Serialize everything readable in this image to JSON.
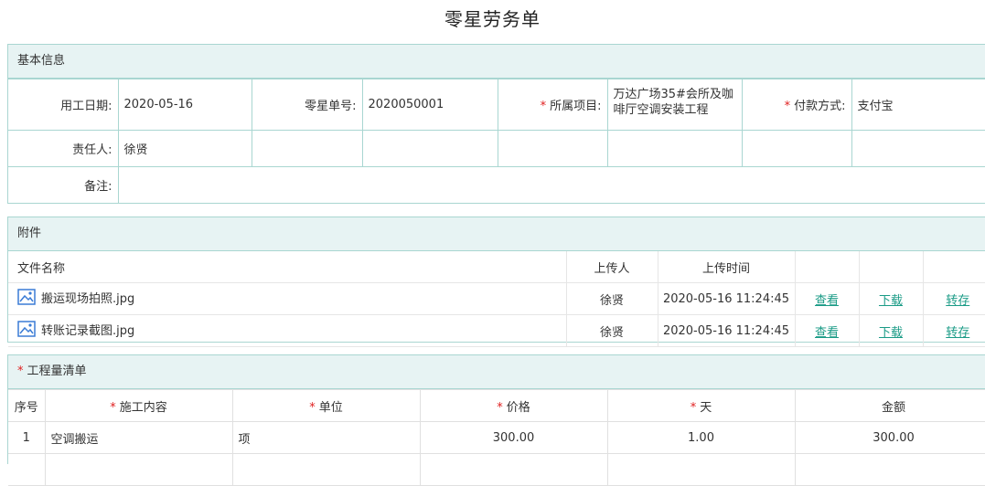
{
  "page_title": "零星劳务单",
  "basic": {
    "section_title": "基本信息",
    "work_date_label": "用工日期:",
    "work_date": "2020-05-16",
    "order_no_label": "零星单号:",
    "order_no": "2020050001",
    "project_label": "所属项目:",
    "project": "万达广场35#会所及咖啡厅空调安装工程",
    "payment_label": "付款方式:",
    "payment": "支付宝",
    "owner_label": "责任人:",
    "owner": "徐贤",
    "remark_label": "备注:",
    "required_mark": "*"
  },
  "attachments": {
    "section_title": "附件",
    "headers": {
      "name": "文件名称",
      "uploader": "上传人",
      "time": "上传时间"
    },
    "rows": [
      {
        "name": "搬运现场拍照.jpg",
        "uploader": "徐贤",
        "time": "2020-05-16 11:24:45",
        "view": "查看",
        "download": "下载",
        "save": "转存"
      },
      {
        "name": "转账记录截图.jpg",
        "uploader": "徐贤",
        "time": "2020-05-16 11:24:45",
        "view": "查看",
        "download": "下载",
        "save": "转存"
      }
    ],
    "icon": "image-file-icon"
  },
  "worklist": {
    "section_title": "工程量清单",
    "required_mark": "*",
    "headers": {
      "seq": "序号",
      "content": "施工内容",
      "unit": "单位",
      "price": "价格",
      "days": "天",
      "amount": "金额"
    },
    "rows": [
      {
        "seq": "1",
        "content": "空调搬运",
        "unit": "项",
        "price": "300.00",
        "days": "1.00",
        "amount": "300.00"
      }
    ]
  },
  "colors": {
    "border": "#a9d6d1",
    "header_bg": "#e7f3f3",
    "link": "#1a9b86",
    "required": "#e02020"
  }
}
